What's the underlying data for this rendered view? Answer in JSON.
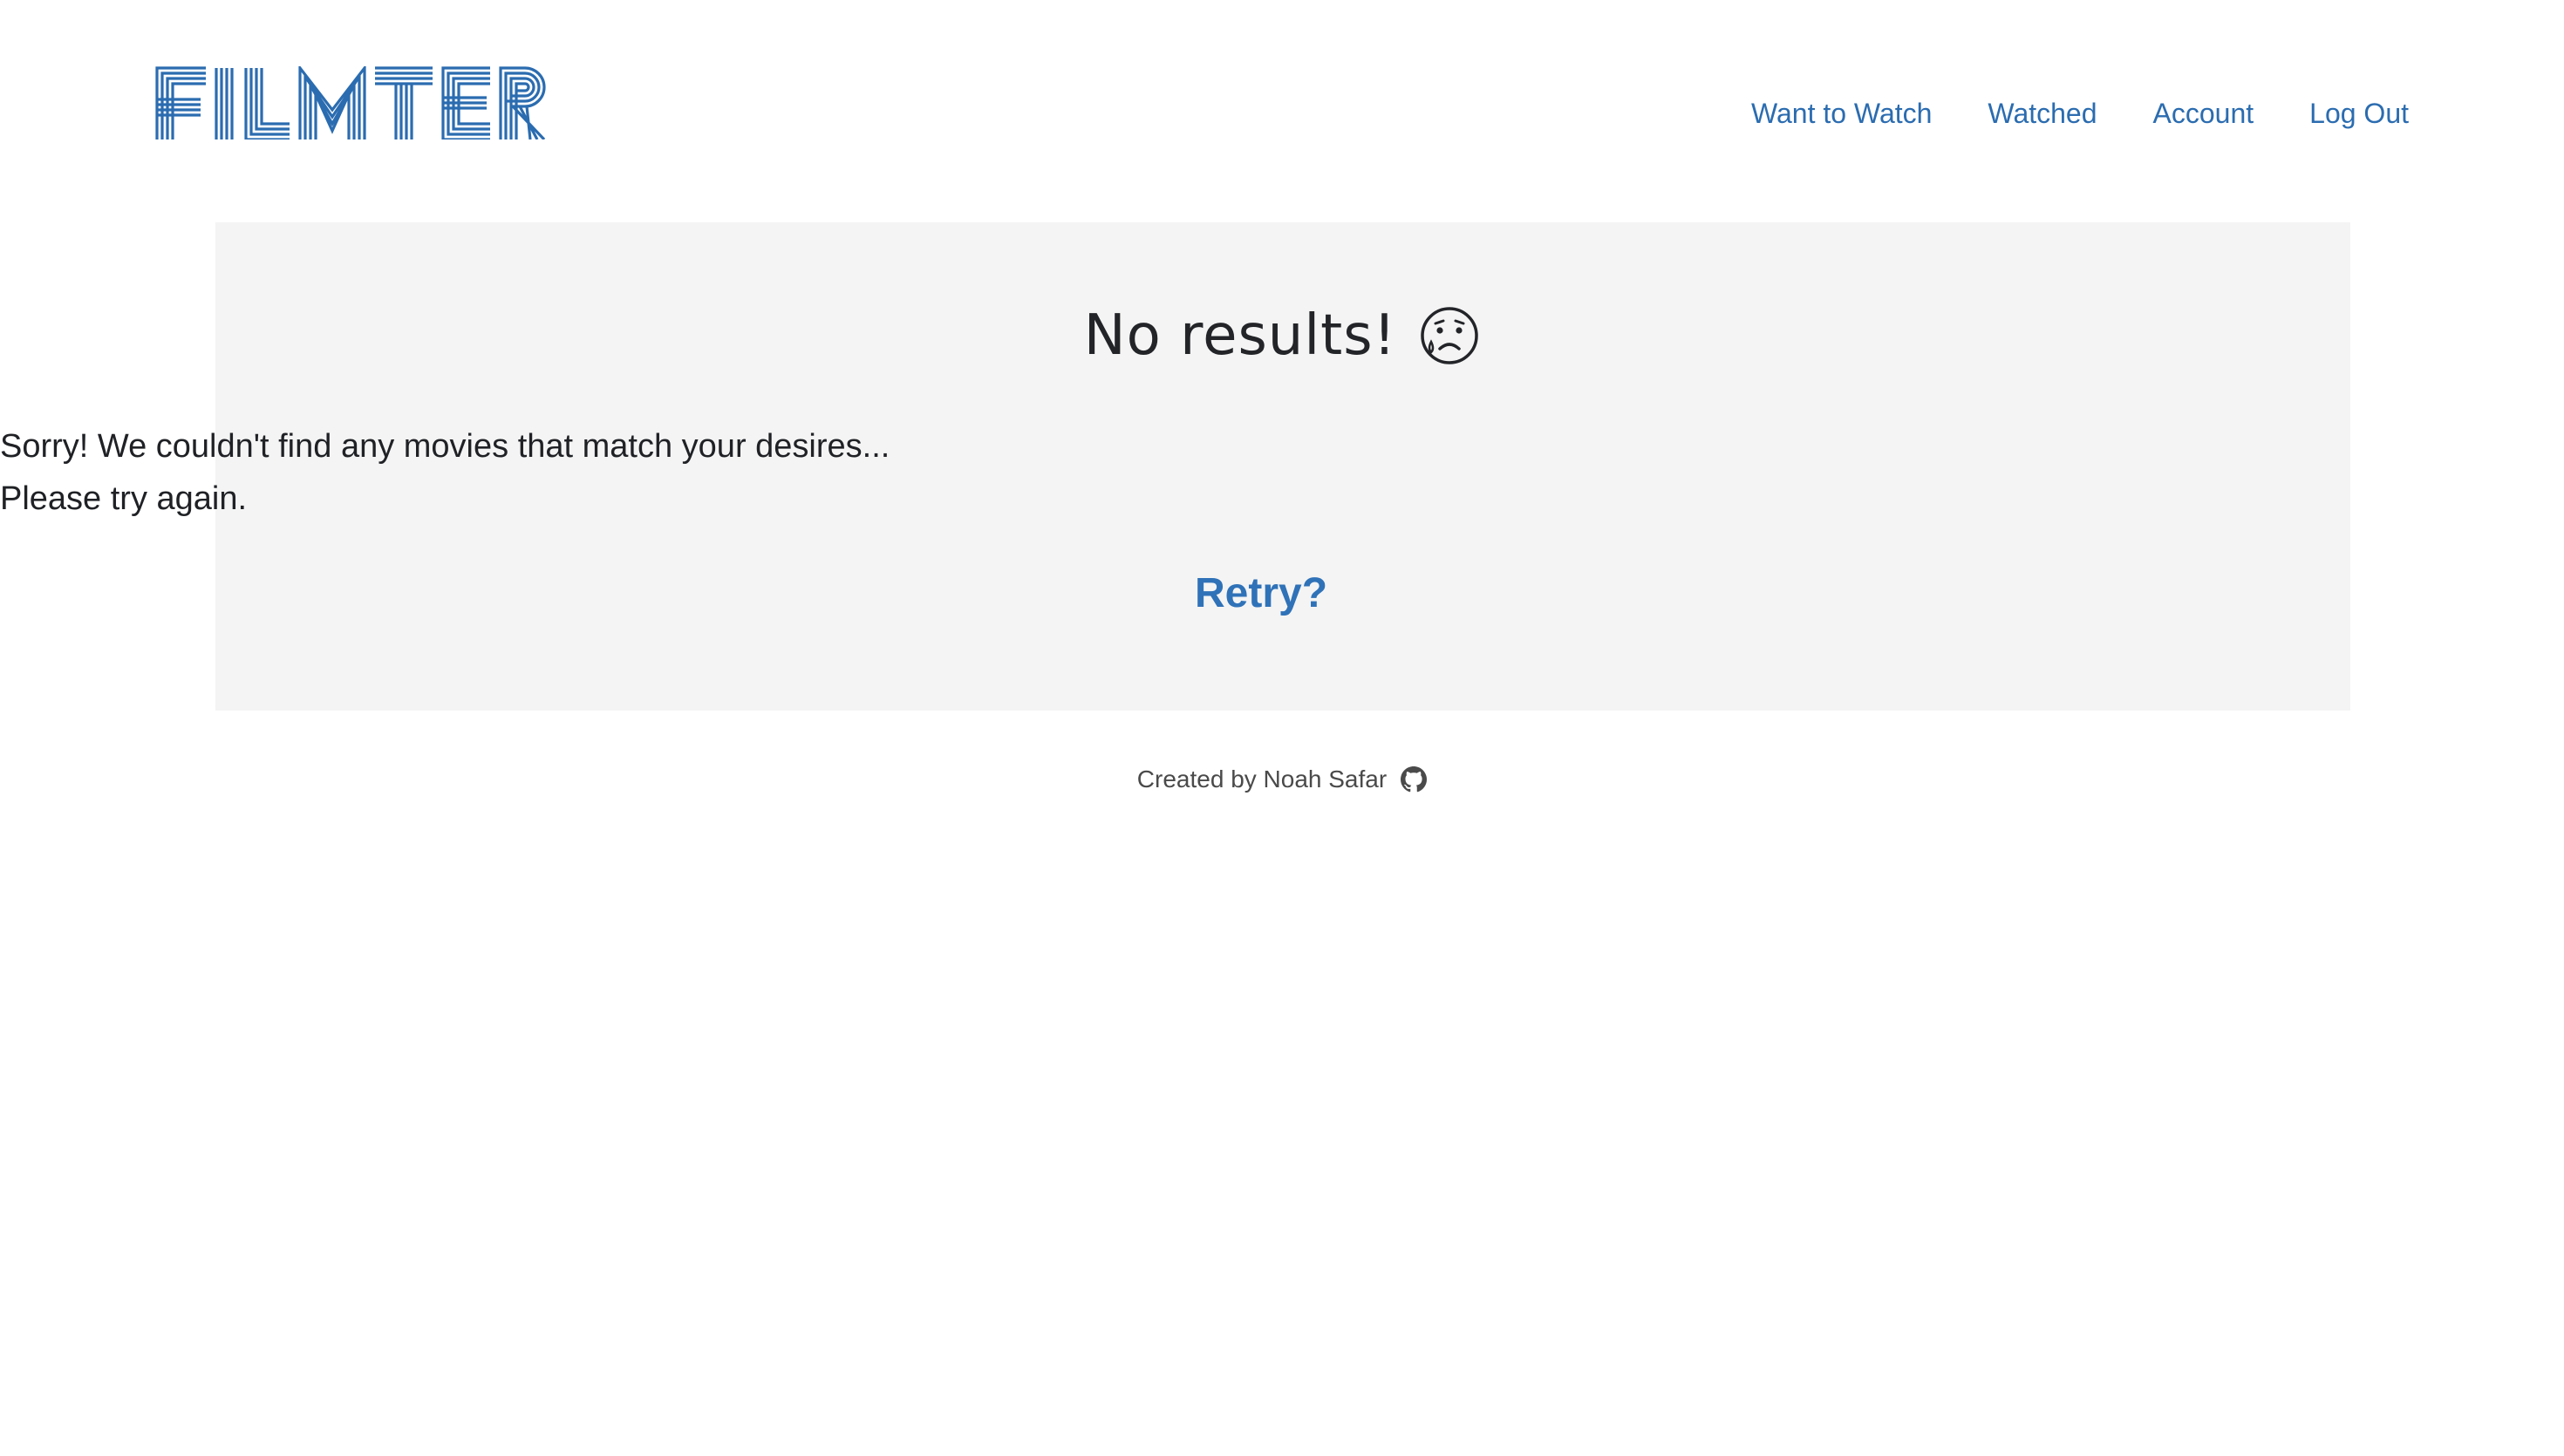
{
  "brand": {
    "logo_text": "FILMTER",
    "accent_color": "#2b6cb0"
  },
  "nav": {
    "items": [
      {
        "label": "Want to Watch"
      },
      {
        "label": "Watched"
      },
      {
        "label": "Account"
      },
      {
        "label": "Log Out"
      }
    ]
  },
  "main": {
    "title": "No results!",
    "title_icon": "sad-face-icon",
    "message_line1": "Sorry! We couldn't find any movies that match your desires...",
    "message_line2": "Please try again.",
    "retry_label": "Retry?",
    "card_background": "#f4f4f4"
  },
  "footer": {
    "credit": "Created by Noah Safar",
    "icon": "github-icon"
  }
}
